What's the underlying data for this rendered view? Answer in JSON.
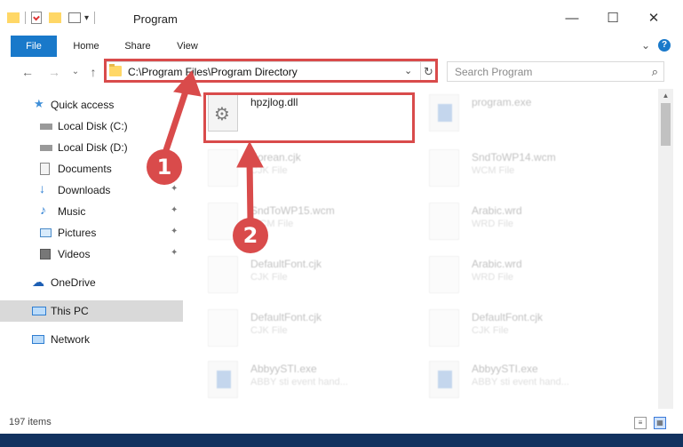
{
  "window": {
    "title": "Program",
    "minimize": "—",
    "maximize": "☐",
    "close": "✕"
  },
  "ribbon": {
    "tabs": [
      "File",
      "Home",
      "Share",
      "View"
    ],
    "chevron": "⌄",
    "help": "?"
  },
  "nav": {
    "back": "←",
    "forward": "→",
    "recent": "⌄",
    "up": "↑"
  },
  "address": {
    "path": "C:\\Program Files\\Program Directory",
    "dropdown": "⌄",
    "refresh": "↻"
  },
  "search": {
    "placeholder": "Search Program",
    "icon": "⌕"
  },
  "sidebar": {
    "items": [
      {
        "label": "Quick access",
        "icon": "star-icon"
      },
      {
        "label": "Local Disk (C:)",
        "icon": "drive-icon"
      },
      {
        "label": "Local Disk (D:)",
        "icon": "drive-icon"
      },
      {
        "label": "Documents",
        "icon": "documents-icon"
      },
      {
        "label": "Downloads",
        "icon": "download-icon"
      },
      {
        "label": "Music",
        "icon": "music-icon"
      },
      {
        "label": "Pictures",
        "icon": "pictures-icon"
      },
      {
        "label": "Videos",
        "icon": "videos-icon"
      },
      {
        "label": "OneDrive",
        "icon": "cloud-icon"
      },
      {
        "label": "This PC",
        "icon": "computer-icon"
      },
      {
        "label": "Network",
        "icon": "network-icon"
      }
    ],
    "pin": "📌"
  },
  "files": [
    {
      "name": "hpzjlog.dll",
      "type": "",
      "icon": "gears"
    },
    {
      "name": "program.exe",
      "type": "",
      "icon": "exe"
    },
    {
      "name": "Korean.cjk",
      "type": "CJK File",
      "icon": "doc"
    },
    {
      "name": "SndToWP14.wcm",
      "type": "WCM File",
      "icon": "doc"
    },
    {
      "name": "SndToWP15.wcm",
      "type": "WCM File",
      "icon": "doc"
    },
    {
      "name": "Arabic.wrd",
      "type": "WRD File",
      "icon": "doc"
    },
    {
      "name": "DefaultFont.cjk",
      "type": "CJK File",
      "icon": "doc"
    },
    {
      "name": "Arabic.wrd",
      "type": "WRD File",
      "icon": "doc"
    },
    {
      "name": "DefaultFont.cjk",
      "type": "CJK File",
      "icon": "doc"
    },
    {
      "name": "DefaultFont.cjk",
      "type": "CJK File",
      "icon": "doc"
    },
    {
      "name": "AbbyySTI.exe",
      "type": "ABBY sti event hand...",
      "icon": "exe"
    },
    {
      "name": "AbbyySTI.exe",
      "type": "ABBY sti event hand...",
      "icon": "exe"
    }
  ],
  "annotations": {
    "badge1": "1",
    "badge2": "2"
  },
  "status": {
    "count": "197 items"
  },
  "colors": {
    "accent": "#1979ca",
    "highlight": "#d94b4b",
    "selected": "#d9d9d9",
    "taskbar": "#12325f"
  }
}
